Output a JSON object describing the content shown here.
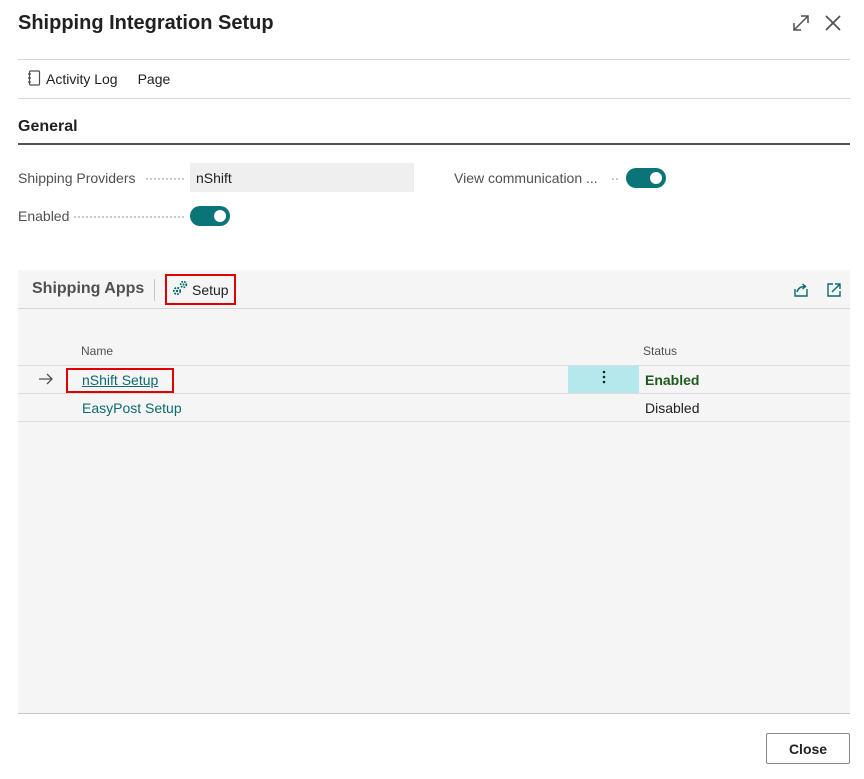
{
  "window": {
    "title": "Shipping Integration Setup",
    "expand_icon": "expand-icon",
    "close_icon": "close-icon"
  },
  "actions": [
    {
      "label": "Activity Log",
      "icon": "notebook-icon"
    },
    {
      "label": "Page"
    }
  ],
  "general": {
    "title": "General",
    "fields": {
      "shipping_providers": {
        "label": "Shipping Providers",
        "value": "nShift"
      },
      "enabled": {
        "label": "Enabled",
        "value": true
      },
      "view_communication": {
        "label": "View communication ...",
        "value": true
      }
    }
  },
  "shipping_apps": {
    "title": "Shipping Apps",
    "setup_label": "Setup",
    "columns": [
      "Name",
      "Status"
    ],
    "rows": [
      {
        "name": "nShift Setup",
        "status": "Enabled",
        "selected": true
      },
      {
        "name": "EasyPost Setup",
        "status": "Disabled",
        "selected": false
      }
    ]
  },
  "footer": {
    "close_label": "Close"
  },
  "colors": {
    "accent": "#0b7479",
    "link": "#0b6a6e",
    "highlight": "#e00000",
    "enabled_status": "#1e5a1e",
    "selected_cell": "#b4e8ec"
  }
}
